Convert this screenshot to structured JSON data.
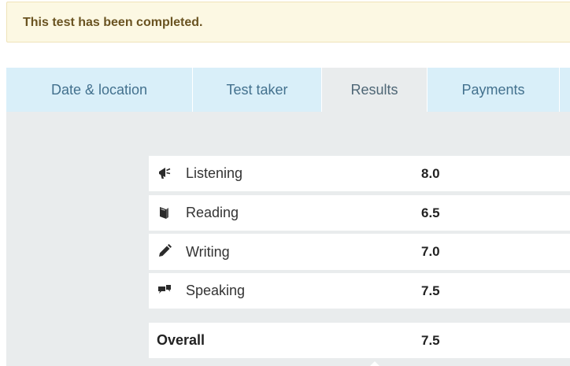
{
  "alert": {
    "message": "This test has been completed."
  },
  "tabs": [
    {
      "label": "Date & location",
      "active": false
    },
    {
      "label": "Test taker",
      "active": false
    },
    {
      "label": "Results",
      "active": true
    },
    {
      "label": "Payments",
      "active": false
    }
  ],
  "results": {
    "rows": [
      {
        "label": "Listening",
        "score": "8.0",
        "icon": "megaphone-icon"
      },
      {
        "label": "Reading",
        "score": "6.5",
        "icon": "book-icon"
      },
      {
        "label": "Writing",
        "score": "7.0",
        "icon": "pencil-icon"
      },
      {
        "label": "Speaking",
        "score": "7.5",
        "icon": "speech-bubbles-icon"
      }
    ],
    "overall": {
      "label": "Overall",
      "score": "7.5"
    }
  },
  "colors": {
    "alert_bg": "#fcf8e3",
    "alert_text": "#6a5321",
    "tab_bg": "#d9eff9",
    "tab_active_bg": "#e9eced",
    "tab_text": "#43718e",
    "panel_bg": "#e9eced"
  }
}
